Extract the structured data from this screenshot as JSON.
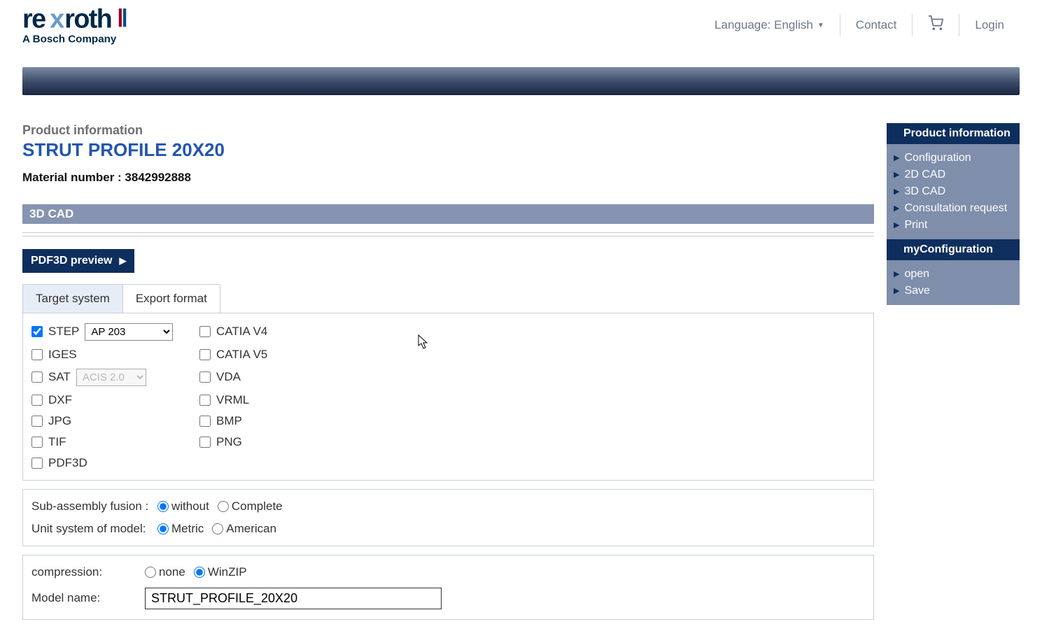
{
  "header": {
    "language_label": "Language: English",
    "contact": "Contact",
    "login": "Login"
  },
  "logo": {
    "tagline": "A Bosch Company"
  },
  "page": {
    "info_label": "Product information",
    "title": "STRUT PROFILE 20X20",
    "material_label": "Material number : 3842992888",
    "section": "3D CAD",
    "pdf_preview": "PDF3D preview"
  },
  "tabs": {
    "target_system": "Target system",
    "export_format": "Export format"
  },
  "formats": {
    "step": "STEP",
    "step_option": "AP 203",
    "catia_v4": "CATIA V4",
    "iges": "IGES",
    "catia_v5": "CATIA V5",
    "sat": "SAT",
    "sat_option": "ACIS 2.0",
    "vda": "VDA",
    "dxf": "DXF",
    "vrml": "VRML",
    "jpg": "JPG",
    "bmp": "BMP",
    "tif": "TIF",
    "png": "PNG",
    "pdf3d": "PDF3D"
  },
  "options": {
    "sub_assembly_label": "Sub-assembly fusion :",
    "without": "without",
    "complete": "Complete",
    "unit_system_label": "Unit system of model:",
    "metric": "Metric",
    "american": "American"
  },
  "compression": {
    "label": "compression:",
    "none": "none",
    "winzip": "WinZIP",
    "model_name_label": "Model name:",
    "model_name_value": "STRUT_PROFILE_20X20"
  },
  "aside": {
    "product_info_header": "Product information",
    "links": {
      "configuration": "Configuration",
      "cad2d": "2D CAD",
      "cad3d": "3D CAD",
      "consultation": "Consultation request",
      "print": "Print"
    },
    "myconfig_header": "myConfiguration",
    "myconfig_links": {
      "open": "open",
      "save": "Save"
    }
  }
}
